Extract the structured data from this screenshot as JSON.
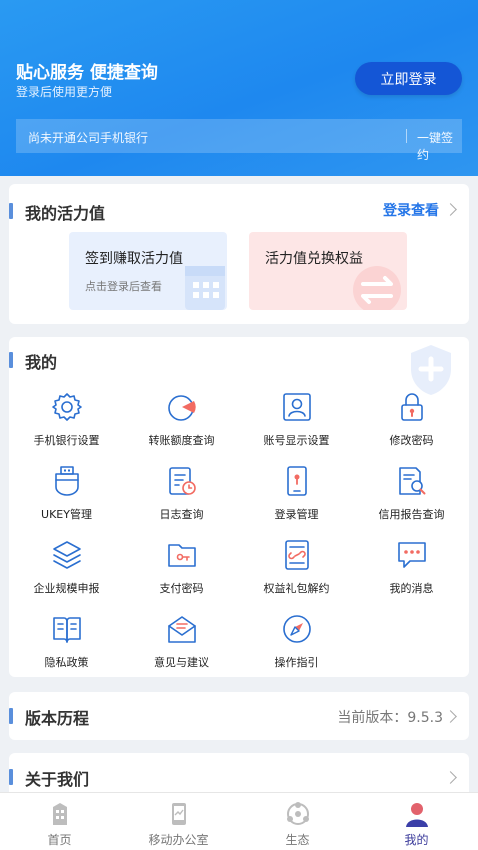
{
  "header": {
    "title": "贴心服务 便捷查询",
    "subtitle": "登录后使用更方便",
    "login_button": "立即登录",
    "notice": "尚未开通公司手机银行",
    "quick_sign": "一键签约"
  },
  "activity": {
    "title": "我的活力值",
    "login_view": "登录查看",
    "checkin_title": "签到赚取活力值",
    "checkin_sub": "点击登录后查看",
    "exchange_title": "活力值兑换权益"
  },
  "mine": {
    "title": "我的",
    "items": [
      {
        "label": "手机银行设置",
        "icon": "gear-icon"
      },
      {
        "label": "转账额度查询",
        "icon": "pie-chart-icon"
      },
      {
        "label": "账号显示设置",
        "icon": "user-card-icon"
      },
      {
        "label": "修改密码",
        "icon": "lock-icon"
      },
      {
        "label": "UKEY管理",
        "icon": "usb-key-icon"
      },
      {
        "label": "日志查询",
        "icon": "log-clipboard-icon"
      },
      {
        "label": "登录管理",
        "icon": "phone-login-icon"
      },
      {
        "label": "信用报告查询",
        "icon": "report-search-icon"
      },
      {
        "label": "企业规模申报",
        "icon": "layers-icon"
      },
      {
        "label": "支付密码",
        "icon": "wallet-key-icon"
      },
      {
        "label": "权益礼包解约",
        "icon": "gift-unlink-icon"
      },
      {
        "label": "我的消息",
        "icon": "message-icon"
      },
      {
        "label": "隐私政策",
        "icon": "book-icon"
      },
      {
        "label": "意见与建议",
        "icon": "envelope-icon"
      },
      {
        "label": "操作指引",
        "icon": "compass-icon"
      }
    ]
  },
  "version": {
    "title": "版本历程",
    "current": "当前版本：9.5.3"
  },
  "about": {
    "title": "关于我们"
  },
  "tabbar": {
    "tabs": [
      {
        "label": "首页",
        "icon": "building-icon"
      },
      {
        "label": "移动办公室",
        "icon": "mobile-office-icon"
      },
      {
        "label": "生态",
        "icon": "ecosystem-icon"
      },
      {
        "label": "我的",
        "icon": "person-icon",
        "active": true
      }
    ]
  },
  "colors": {
    "header_blue": "#1e88ef",
    "accent_blue": "#2576e8",
    "button_blue": "#1456d6",
    "icon_blue": "#2b6fd0",
    "icon_red": "#f26b62"
  }
}
